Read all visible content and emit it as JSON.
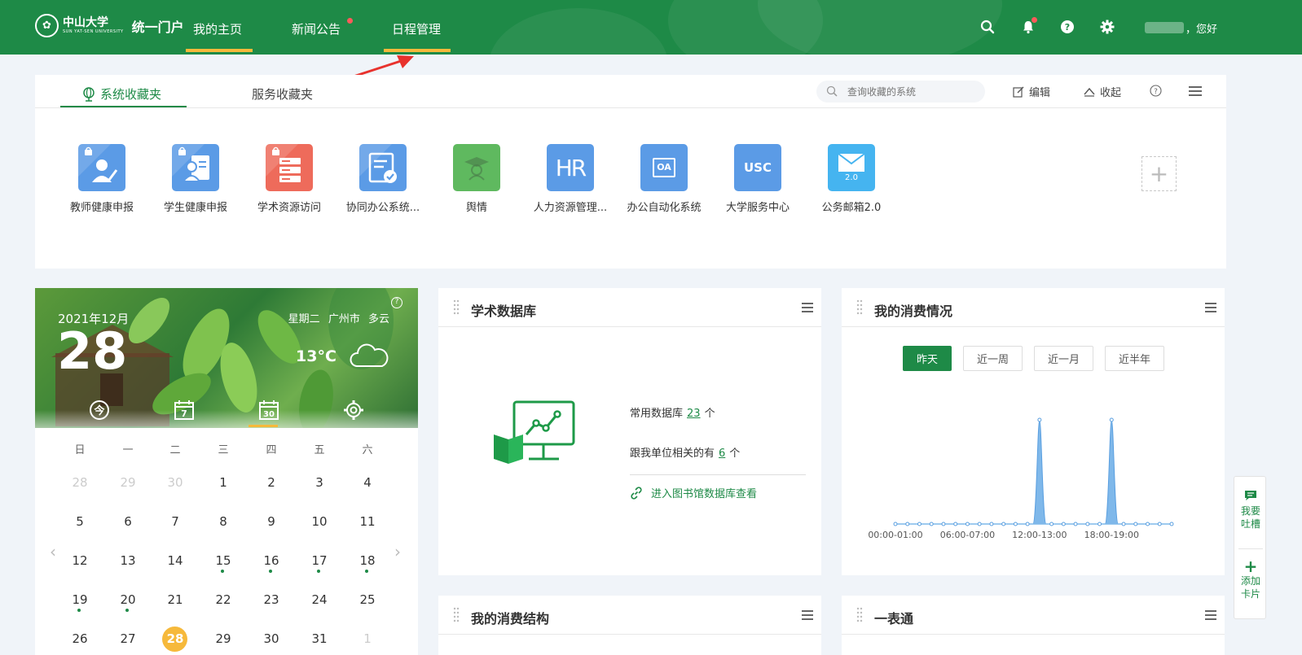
{
  "header": {
    "university_name": "中山大学",
    "university_en": "SUN YAT-SEN UNIVERSITY",
    "portal_name": "统一门户",
    "nav": [
      {
        "label": "我的主页"
      },
      {
        "label": "新闻公告"
      },
      {
        "label": "日程管理"
      }
    ],
    "greeting": "，您好",
    "colors": {
      "primary": "#1e8a47",
      "accent": "#f6b93b",
      "notification": "#ff5a5a"
    }
  },
  "favorites": {
    "tabs": [
      {
        "label": "系统收藏夹"
      },
      {
        "label": "服务收藏夹"
      }
    ],
    "search_placeholder": "查询收藏的系统",
    "edit_label": "编辑",
    "collapse_label": "收起",
    "apps": [
      {
        "label": "教师健康申报",
        "color": "#5b9be6",
        "icon": "teacher-report-icon"
      },
      {
        "label": "学生健康申报",
        "color": "#5b9be6",
        "icon": "student-report-icon"
      },
      {
        "label": "学术资源访问",
        "color": "#ee6b5b",
        "icon": "server-icon"
      },
      {
        "label": "协同办公系统...",
        "color": "#5b9be6",
        "icon": "document-check-icon"
      },
      {
        "label": "舆情",
        "color": "#5fb95f",
        "icon": "graduate-icon"
      },
      {
        "label": "人力资源管理...",
        "color": "#5b9be6",
        "icon": "hr-icon",
        "text": "HR"
      },
      {
        "label": "办公自动化系统",
        "color": "#5b9be6",
        "icon": "oa-icon",
        "text": "OA"
      },
      {
        "label": "大学服务中心",
        "color": "#5b9be6",
        "icon": "usc-icon",
        "text": "USC"
      },
      {
        "label": "公务邮箱2.0",
        "color": "#45b4f0",
        "icon": "mail-icon",
        "text": "2.0"
      }
    ]
  },
  "calendar": {
    "year_month": "2021年12月",
    "day": "28",
    "weekday": "星期二",
    "city": "广州市",
    "weather": "多云",
    "temperature": "13°C",
    "today_tool_label": "今",
    "week_tool_label": "7",
    "month_tool_label": "30",
    "weekdays": [
      "日",
      "一",
      "二",
      "三",
      "四",
      "五",
      "六"
    ],
    "rows": [
      [
        "28",
        "29",
        "30",
        "1",
        "2",
        "3",
        "4"
      ],
      [
        "5",
        "6",
        "7",
        "8",
        "9",
        "10",
        "11"
      ],
      [
        "12",
        "13",
        "14",
        "15",
        "16",
        "17",
        "18"
      ],
      [
        "19",
        "20",
        "21",
        "22",
        "23",
        "24",
        "25"
      ],
      [
        "26",
        "27",
        "28",
        "29",
        "30",
        "31",
        "1"
      ]
    ],
    "muted": [
      "0-0",
      "0-1",
      "0-2",
      "4-6"
    ],
    "event_dots": [
      "2-3",
      "2-4",
      "2-5",
      "2-6",
      "3-0",
      "3-1"
    ],
    "today": "4-2"
  },
  "database_card": {
    "title": "学术数据库",
    "common_label": "常用数据库",
    "common_count": "23",
    "related_label": "跟我单位相关的有",
    "related_count": "6",
    "unit": "个",
    "link_text": "进入图书馆数据库查看"
  },
  "consumption_card": {
    "title": "我的消费情况",
    "filters": [
      {
        "label": "昨天",
        "active": true
      },
      {
        "label": "近一周",
        "active": false
      },
      {
        "label": "近一月",
        "active": false
      },
      {
        "label": "近半年",
        "active": false
      }
    ],
    "chart_data": {
      "type": "area",
      "x": [
        "00:00-01:00",
        "01:00-02:00",
        "02:00-03:00",
        "03:00-04:00",
        "04:00-05:00",
        "05:00-06:00",
        "06:00-07:00",
        "07:00-08:00",
        "08:00-09:00",
        "09:00-10:00",
        "10:00-11:00",
        "11:00-12:00",
        "12:00-13:00",
        "13:00-14:00",
        "14:00-15:00",
        "15:00-16:00",
        "16:00-17:00",
        "17:00-18:00",
        "18:00-19:00",
        "19:00-20:00",
        "20:00-21:00",
        "21:00-22:00",
        "22:00-23:00",
        "23:00-24:00"
      ],
      "tick_labels": [
        "00:00-01:00",
        "06:00-07:00",
        "12:00-13:00",
        "18:00-19:00"
      ],
      "values": [
        0,
        0,
        0,
        0,
        0,
        0,
        0,
        0,
        0,
        0,
        0,
        0,
        1,
        0,
        0,
        0,
        0,
        0,
        1,
        0,
        0,
        0,
        0,
        0
      ],
      "color": "#7fb8ea",
      "grid": false,
      "xlabel": "",
      "ylabel": ""
    }
  },
  "structure_card": {
    "title": "我的消费结构"
  },
  "table_card": {
    "title": "一表通"
  },
  "side_float": {
    "feedback_lines": [
      "我要",
      "吐槽"
    ],
    "add_card_lines": [
      "添加",
      "卡片"
    ]
  }
}
